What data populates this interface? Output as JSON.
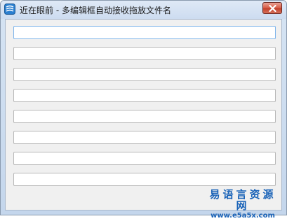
{
  "window": {
    "title": "近在眼前 - 多编辑框自动接收拖放文件名",
    "app_icon": "app-logo-icon",
    "close_icon": "close-icon",
    "accent_color": "#c2412b"
  },
  "fields": [
    {
      "value": "",
      "placeholder": ""
    },
    {
      "value": "",
      "placeholder": ""
    },
    {
      "value": "",
      "placeholder": ""
    },
    {
      "value": "",
      "placeholder": ""
    },
    {
      "value": "",
      "placeholder": ""
    },
    {
      "value": "",
      "placeholder": ""
    },
    {
      "value": "",
      "placeholder": ""
    },
    {
      "value": "",
      "placeholder": ""
    }
  ],
  "watermark": {
    "line1": "易语言资源网",
    "line2": "www.e5a5x.com"
  }
}
